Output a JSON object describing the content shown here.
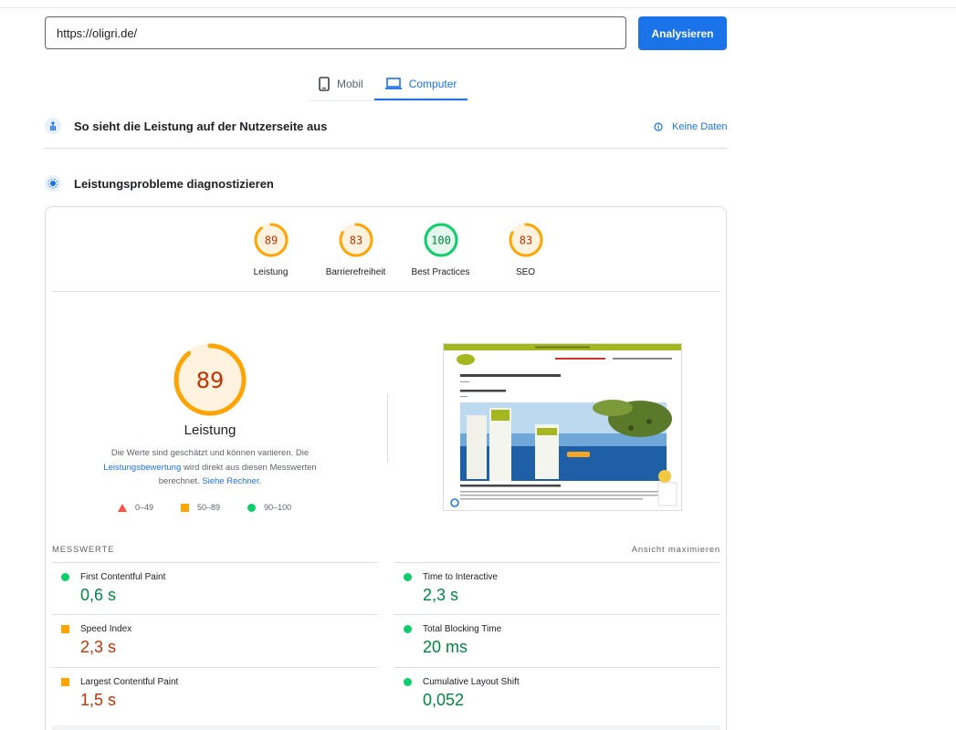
{
  "search": {
    "url": "https://oligri.de/",
    "button": "Analysieren"
  },
  "tabs": [
    {
      "label": "Mobil",
      "active": false
    },
    {
      "label": "Computer",
      "active": true
    }
  ],
  "field_section": {
    "title": "So sieht die Leistung auf der Nutzerseite aus",
    "no_data": "Keine Daten"
  },
  "lab_section": {
    "title": "Leistungsprobleme diagnostizieren"
  },
  "scores": [
    {
      "label": "Leistung",
      "value": 89,
      "status": "average"
    },
    {
      "label": "Barrierefreiheit",
      "value": 83,
      "status": "average"
    },
    {
      "label": "Best Practices",
      "value": 100,
      "status": "pass"
    },
    {
      "label": "SEO",
      "value": 83,
      "status": "average"
    }
  ],
  "performance": {
    "score": 89,
    "title": "Leistung",
    "desc_1": "Die Werte sind geschätzt und können variieren. Die",
    "link_1": "Leistungsbewertung",
    "desc_2": " wird direkt aus diesen Messwerten berechnet.",
    "link_2": "Siehe Rechner."
  },
  "legend": [
    {
      "shape": "triangle",
      "color": "#ff4e42",
      "label": "0–49"
    },
    {
      "shape": "square",
      "color": "#ffa400",
      "label": "50–89"
    },
    {
      "shape": "circle",
      "color": "#0cce6b",
      "label": "90–100"
    }
  ],
  "metrics_header": {
    "title": "MESSWERTE",
    "action": "Ansicht maximieren"
  },
  "metrics": [
    {
      "name": "First Contentful Paint",
      "value": "0,6 s",
      "status": "pass"
    },
    {
      "name": "Time to Interactive",
      "value": "2,3 s",
      "status": "pass"
    },
    {
      "name": "Speed Index",
      "value": "2,3 s",
      "status": "average"
    },
    {
      "name": "Total Blocking Time",
      "value": "20 ms",
      "status": "pass"
    },
    {
      "name": "Largest Contentful Paint",
      "value": "1,5 s",
      "status": "average"
    },
    {
      "name": "Cumulative Layout Shift",
      "value": "0,052",
      "status": "pass"
    }
  ],
  "colors": {
    "accent": "#1a73e8",
    "pass": "#0cce6b",
    "average": "#ffa400",
    "fail": "#ff4e42"
  }
}
